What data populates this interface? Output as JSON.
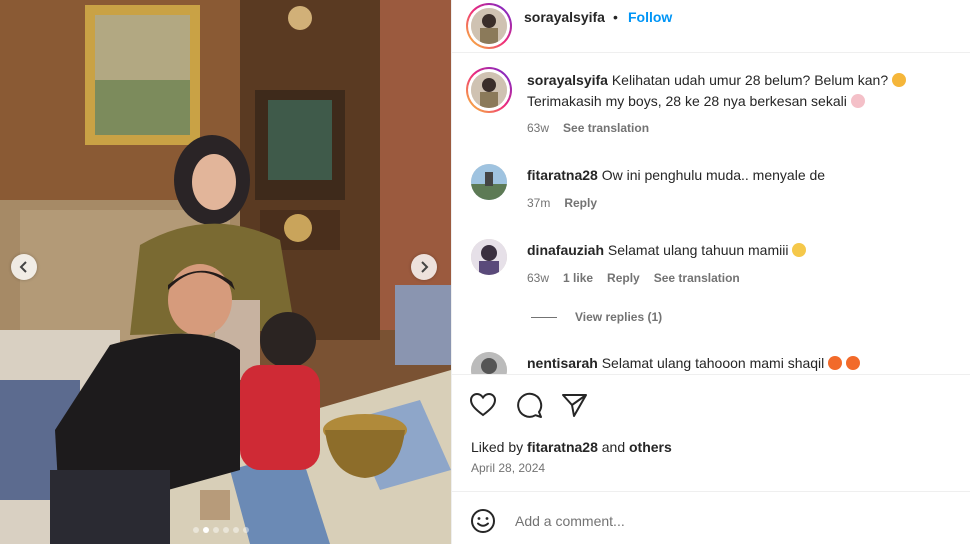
{
  "post": {
    "image_alt": "Family photo: a woman in a brown sweater and black hijab, a man in a black shirt and a toddler in a red outfit gathered around a brass bowl on a tiled table in a wood-panelled room",
    "carousel": {
      "total": 6,
      "current": 2
    }
  },
  "header": {
    "username": "sorayalsyifa",
    "bullet": "•",
    "follow_label": "Follow"
  },
  "comments": [
    {
      "username": "sorayalsyifa",
      "text": "Kelihatan udah umur 28 belum? Belum kan?",
      "text_line2": "Terimakasih my boys, 28 ke 28 nya berkesan sekali",
      "time": "63w",
      "see_translation": "See translation"
    },
    {
      "username": "fitaratna28",
      "text": "Ow ini penghulu muda.. menyale de",
      "time": "37m",
      "reply": "Reply"
    },
    {
      "username": "dinafauziah",
      "text": "Selamat ulang tahuun mamiii",
      "time": "63w",
      "likes": "1 like",
      "reply": "Reply",
      "see_translation": "See translation",
      "view_replies": "View replies (1)"
    },
    {
      "username": "nentisarah",
      "text": "Selamat ulang tahooon mami shaqil"
    }
  ],
  "actions": {
    "liked_prefix": "Liked by",
    "liked_user": "fitaratna28",
    "liked_and": "and",
    "liked_others": "others",
    "date": "April 28, 2024"
  },
  "add_comment": {
    "placeholder": "Add a comment..."
  },
  "colors": {
    "follow": "#0095f6",
    "muted": "#737373",
    "text": "#262626"
  }
}
